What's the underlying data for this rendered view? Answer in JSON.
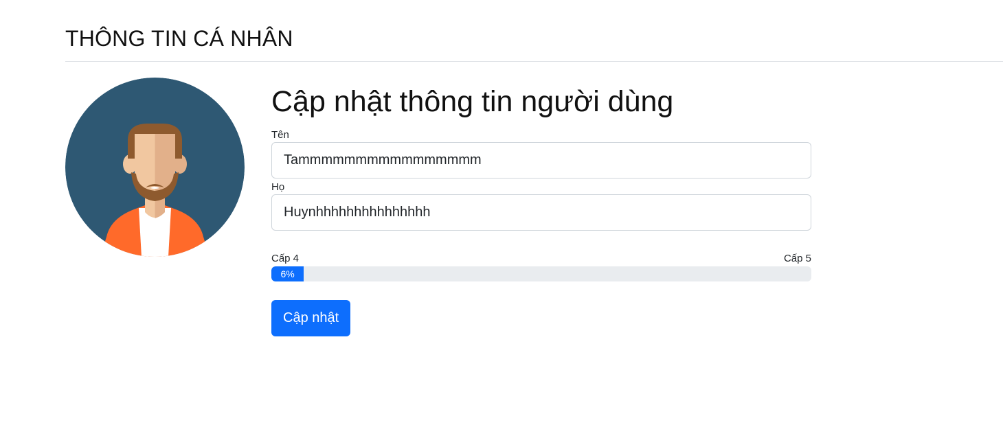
{
  "header": {
    "title": "THÔNG TIN CÁ NHÂN"
  },
  "avatar": {
    "icon": "user-avatar-icon",
    "colors": {
      "background": "#2e5873",
      "hair": "#8e5a2e",
      "skin_light": "#f1c7a0",
      "skin_shadow": "#e2b08a",
      "jacket": "#ff6a2a",
      "shirt": "#ffffff"
    }
  },
  "form": {
    "heading": "Cập nhật thông tin người dùng",
    "first_name": {
      "label": "Tên",
      "value": "Tammmmmmmmmmmmmmmm"
    },
    "last_name": {
      "label": "Họ",
      "value": "Huynhhhhhhhhhhhhhhh"
    },
    "level": {
      "current_label": "Cấp 4",
      "next_label": "Cấp 5",
      "progress_percent": 6,
      "progress_text": "6%"
    },
    "submit_label": "Cập nhật"
  },
  "colors": {
    "primary": "#0d6efd",
    "progress_track": "#e9ecef",
    "border": "#ced4da"
  }
}
